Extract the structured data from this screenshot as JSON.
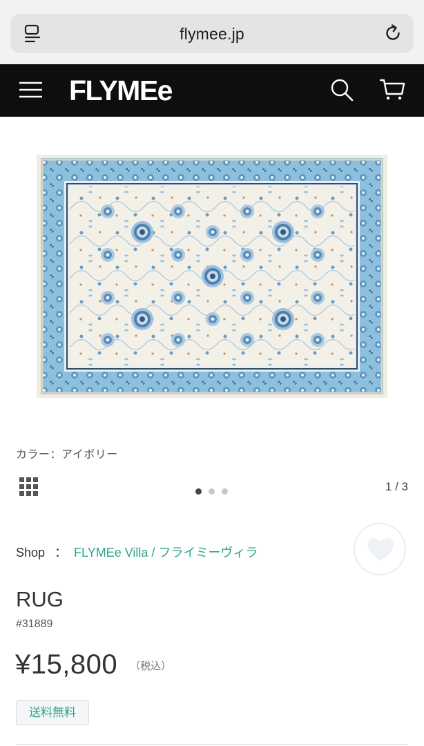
{
  "browser": {
    "url": "flymee.jp",
    "icons": [
      "reader-icon",
      "reload-icon"
    ]
  },
  "header": {
    "brand": "FLYMEe",
    "icons": [
      "menu-icon",
      "search-icon",
      "cart-icon"
    ],
    "background_color": "#0e0e0e"
  },
  "gallery": {
    "color_label": "カラー：アイボリー",
    "page_counter": "1 / 3",
    "dots_total": 3,
    "active_dot": 1
  },
  "shop": {
    "label": "Shop",
    "colon": "：",
    "link_text": "FLYMEe Villa / フライミーヴィラ",
    "link_color": "#2fa38b"
  },
  "product": {
    "title": "RUG",
    "code": "#31889",
    "price": "¥15,800",
    "tax_note": "（税込）",
    "badge": "送料無料"
  },
  "colors": {
    "accent": "#2fa38b",
    "rug_border": "#8cc0de",
    "rug_field": "#f3f0e8"
  }
}
